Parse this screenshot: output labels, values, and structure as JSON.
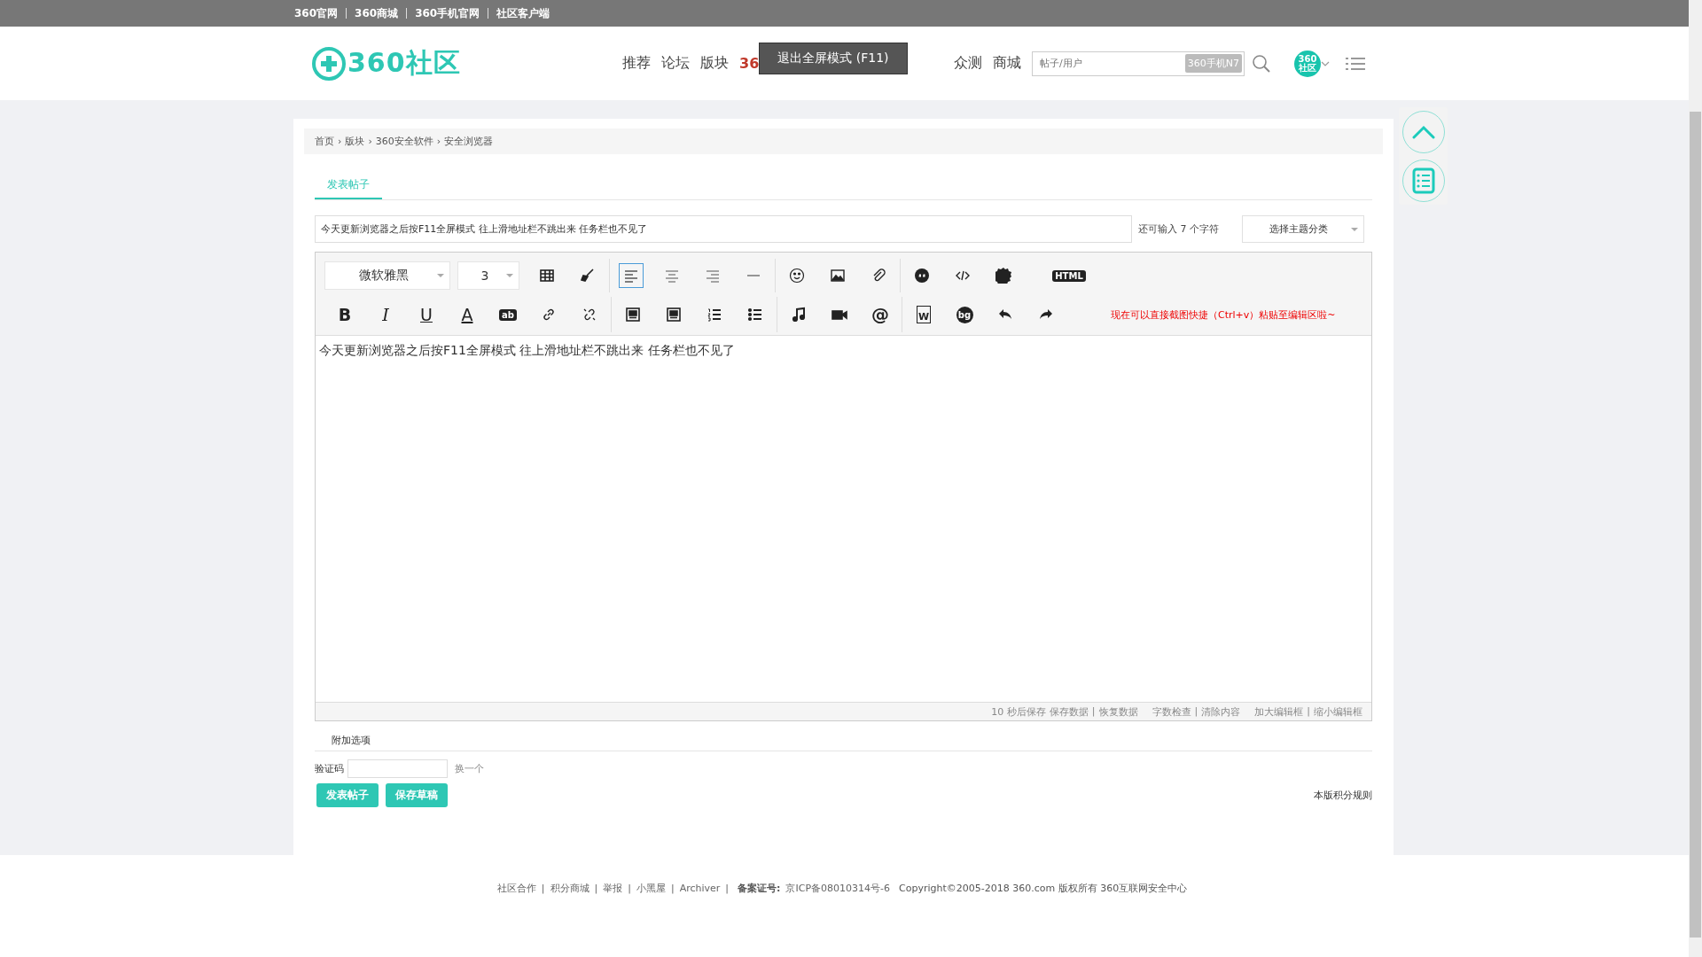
{
  "top_links": [
    "360官网",
    "360商城",
    "360手机官网",
    "社区客户端"
  ],
  "logo": {
    "text": "360社区"
  },
  "nav": [
    {
      "label": "推荐",
      "kind": "link"
    },
    {
      "label": "论坛",
      "kind": "link"
    },
    {
      "label": "版块",
      "kind": "link"
    },
    {
      "label": "36",
      "kind": "hot"
    },
    {
      "label": "众测",
      "kind": "link"
    },
    {
      "label": "商城",
      "kind": "link"
    }
  ],
  "tooltip": "退出全屏模式 (F11)",
  "search": {
    "placeholder": "帖子/用户",
    "tag": "360手机N7"
  },
  "avatar": {
    "line1": "360",
    "line2": "社区"
  },
  "breadcrumb": [
    "首页",
    "版块",
    "360安全软件",
    "安全浏览器"
  ],
  "breadcrumb_separator": "›",
  "tabs": [
    {
      "label": "发表帖子",
      "selected": true
    }
  ],
  "title_field": {
    "value": "今天更新浏览器之后按F11全屏模式 往上滑地址栏不跳出来 任务栏也不见了"
  },
  "counter": {
    "prefix": "还可输入",
    "count": "7",
    "suffix": "个字符"
  },
  "category_select": {
    "value": "选择主题分类"
  },
  "toolbar_row1": [
    {
      "kind": "font-select",
      "label": "微软雅黑"
    },
    {
      "kind": "size-select",
      "label": "3"
    },
    {
      "kind": "table"
    },
    {
      "kind": "brush"
    },
    {
      "kind": "sep"
    },
    {
      "kind": "align-left",
      "selected": true
    },
    {
      "kind": "align-center",
      "selected": false
    },
    {
      "kind": "align-right",
      "selected": false
    },
    {
      "kind": "hr"
    },
    {
      "kind": "sep"
    },
    {
      "kind": "emoji"
    },
    {
      "kind": "image"
    },
    {
      "kind": "attach"
    },
    {
      "kind": "sep"
    },
    {
      "kind": "quote"
    },
    {
      "kind": "code"
    },
    {
      "kind": "free"
    },
    {
      "kind": "spacer"
    },
    {
      "kind": "tag",
      "label": "HTML"
    }
  ],
  "toolbar_row2": [
    {
      "kind": "bold",
      "label": "B"
    },
    {
      "kind": "italic",
      "label": "I"
    },
    {
      "kind": "underline",
      "label": "U"
    },
    {
      "kind": "font-color",
      "label": "A"
    },
    {
      "kind": "tag",
      "label": "ab"
    },
    {
      "kind": "link"
    },
    {
      "kind": "unlink"
    },
    {
      "kind": "sep"
    },
    {
      "kind": "float-left"
    },
    {
      "kind": "float-right"
    },
    {
      "kind": "ol"
    },
    {
      "kind": "ul"
    },
    {
      "kind": "sep"
    },
    {
      "kind": "music"
    },
    {
      "kind": "video"
    },
    {
      "kind": "at",
      "label": "@"
    },
    {
      "kind": "sep"
    },
    {
      "kind": "doc",
      "label": "W"
    },
    {
      "kind": "round",
      "label": "bg"
    },
    {
      "kind": "undo"
    },
    {
      "kind": "redo"
    }
  ],
  "toolbar_hint": "现在可以直接截图快捷（Ctrl+v）粘贴至编辑区啦~",
  "editor_content": "今天更新浏览器之后按F11全屏模式 往上滑地址栏不跳出来 任务栏也不见了",
  "editor_status": {
    "note": "10 秒后保存",
    "separator": "|",
    "groups": [
      [
        "保存数据",
        "恢复数据"
      ],
      [
        "字数检查",
        "清除内容"
      ],
      [
        "加大编辑框",
        "缩小编辑框"
      ]
    ]
  },
  "extra_options": "附加选项",
  "captcha": {
    "label": "验证码",
    "refresh": "换一个"
  },
  "buttons": [
    "发表帖子",
    "保存草稿"
  ],
  "rules_link": "本版积分规则",
  "footer": {
    "separator": "|",
    "links": [
      "社区合作",
      "积分商城",
      "举报",
      "小黑屋",
      "Archiver"
    ],
    "icp_label": "备案证号:",
    "icp": "京ICP备08010314号-6",
    "copyright": "Copyright©2005-2018 360.com 版权所有 360互联网安全中心"
  }
}
